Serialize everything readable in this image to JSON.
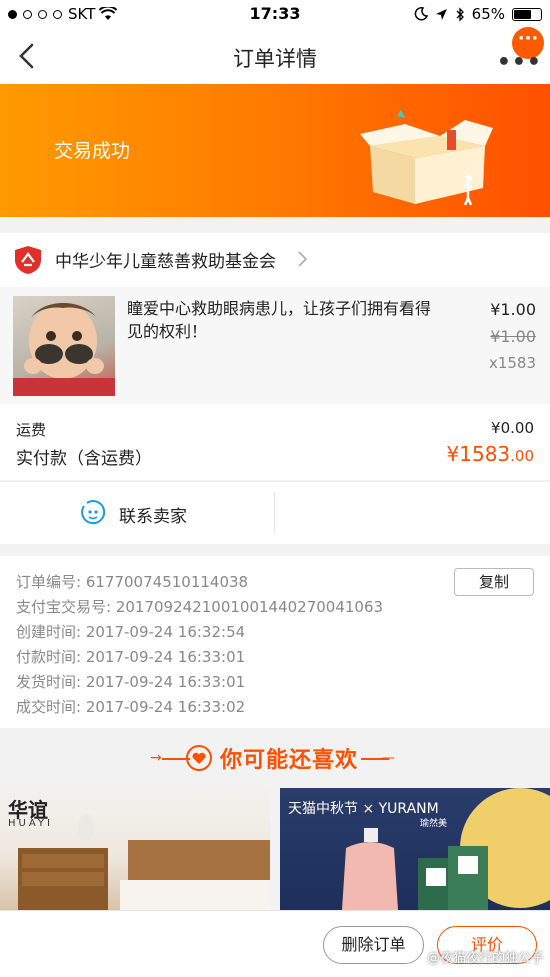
{
  "status_bar": {
    "carrier": "SKT",
    "time": "17:33",
    "battery": "65%",
    "battery_level": 0.65
  },
  "nav": {
    "title": "订单详情",
    "more_badge": "···",
    "more_dots": "•••"
  },
  "banner": {
    "status": "交易成功"
  },
  "seller": {
    "name": "中华少年儿童慈善救助基金会"
  },
  "product": {
    "description": "瞳爱中心救助眼病患儿，让孩子们拥有看得见的权利！",
    "price": "¥1.00",
    "original_price": "¥1.00",
    "quantity": "x1583"
  },
  "totals": {
    "shipping_label": "运费",
    "shipping_value": "¥0.00",
    "paid_label": "实付款（含运费）",
    "paid_integer": "¥1583",
    "paid_decimal": ".00"
  },
  "contact": {
    "label": "联系卖家"
  },
  "order_info": {
    "copy_label": "复制",
    "rows": [
      {
        "label": "订单编号:",
        "value": "61770074510114038"
      },
      {
        "label": "支付宝交易号:",
        "value": "2017092421001001440270041063"
      },
      {
        "label": "创建时间:",
        "value": "2017-09-24 16:32:54"
      },
      {
        "label": "付款时间:",
        "value": "2017-09-24 16:33:01"
      },
      {
        "label": "发货时间:",
        "value": "2017-09-24 16:33:01"
      },
      {
        "label": "成交时间:",
        "value": "2017-09-24 16:33:02"
      }
    ]
  },
  "recommend": {
    "title": "你可能还喜欢",
    "left_brand": "华谊",
    "left_brand_en": "HUAYI",
    "right_promo": "天猫中秋节 × YURANM",
    "right_brand_cn": "瑜然美"
  },
  "bottom": {
    "delete_label": "删除订单",
    "rate_label": "评价",
    "watermark": "@夜猫夜行的独公子"
  },
  "colors": {
    "accent": "#ff5000",
    "banner_start": "#ff9a00",
    "banner_end": "#ff5000"
  }
}
